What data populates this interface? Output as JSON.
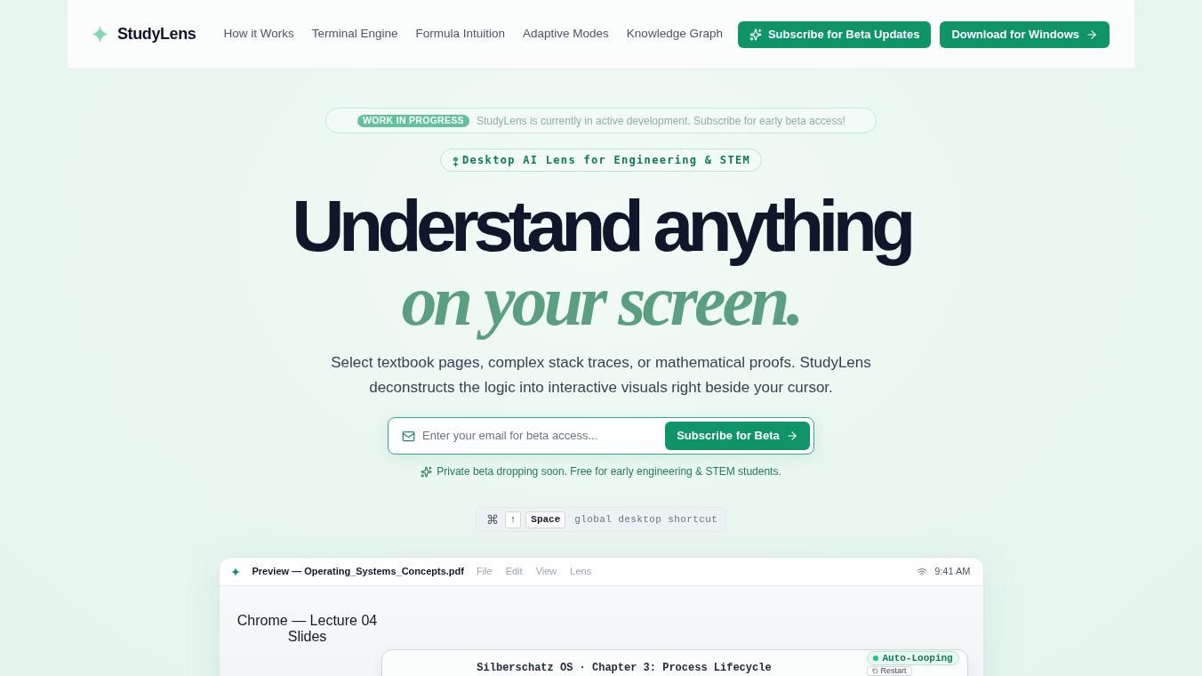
{
  "header": {
    "logo": "StudyLens",
    "nav": [
      "How it Works",
      "Terminal Engine",
      "Formula Intuition",
      "Adaptive Modes",
      "Knowledge Graph"
    ],
    "buttons": [
      {
        "label": "Subscribe for Beta Updates",
        "kind": "subscribe"
      },
      {
        "label": "Download for Windows",
        "kind": "download"
      }
    ]
  },
  "banner": {
    "badge": "WORK IN PROGRESS",
    "text": "StudyLens is currently in active development. Subscribe for early beta access!"
  },
  "eyebrow": "Desktop AI Lens for Engineering & STEM",
  "headline": {
    "line_1": "Understand anything",
    "line_2": "on your screen."
  },
  "subtitle": "Select textbook pages, complex stack traces, or mathematical proofs. StudyLens deconstructs the logic into interactive visuals right beside your cursor.",
  "signup": {
    "placeholder": "Enter your email for beta access...",
    "button": "Subscribe for Beta",
    "note": "Private beta dropping soon. Free for early engineering & STEM students."
  },
  "shortcut": {
    "keys": [
      {
        "label": "⌘",
        "kind": "symbol"
      },
      {
        "label": "↑",
        "kind": "key"
      },
      {
        "label": "Space",
        "kind": "key"
      }
    ],
    "label": "global desktop shortcut"
  },
  "preview": {
    "title": "Preview — Operating_Systems_Concepts.pdf",
    "menu": [
      "File",
      "Edit",
      "View",
      "Lens"
    ],
    "time": "9:41 AM",
    "source_label": "Chrome — Lecture 04 Slides",
    "card": {
      "title": "Silberschatz OS · Chapter 3: Process Lifecycle",
      "status": "Auto-Looping",
      "button": "Restart"
    }
  }
}
